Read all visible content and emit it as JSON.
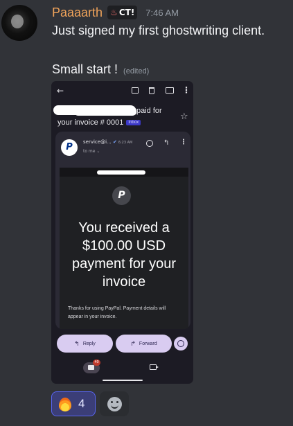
{
  "author": {
    "username": "Paaaarth",
    "tag_icon": "flame-icon",
    "tag_text": "CT!",
    "timestamp": "7:46 AM"
  },
  "messages": [
    {
      "text": "Just signed my first ghostwriting client."
    },
    {
      "text": "Small start !",
      "edited_label": "(edited)"
    }
  ],
  "attachment": {
    "subject_line1_suffix": "paid for",
    "subject_line2": "your invoice # 0001",
    "inbox_label": "Inbox",
    "sender": "service@i...",
    "sent_time": "6:23 AM",
    "recipient": "to me",
    "logo_letter": "P",
    "headline": "You received a $100.00 USD payment for your invoice",
    "body_text": "Thanks for using PayPal. Payment details will appear in your invoice.",
    "reply_label": "Reply",
    "forward_label": "Forward",
    "mail_badge_count": "40"
  },
  "reactions": [
    {
      "emoji": "fire",
      "count": "4",
      "active": true
    }
  ],
  "colors": {
    "username": "#f0a35a",
    "reaction_active_bg": "#3b3e77",
    "reaction_active_border": "#5865f2",
    "mail_button_bg": "#d9ccf1"
  }
}
